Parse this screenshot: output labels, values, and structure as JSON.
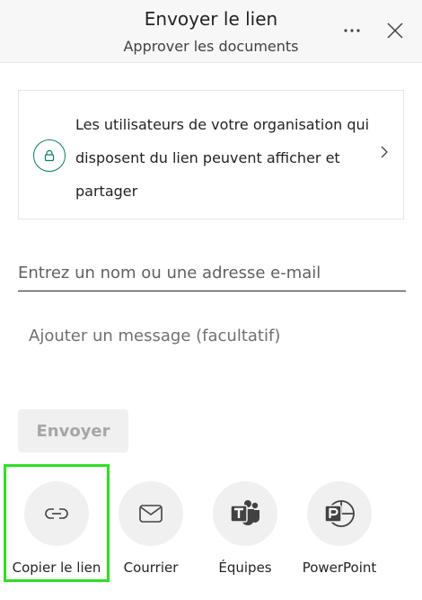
{
  "header": {
    "title": "Envoyer le lien",
    "subtitle": "Approver les documents",
    "more_icon": "more-horizontal-icon",
    "close_icon": "close-icon"
  },
  "link_settings": {
    "description": "Les utilisateurs de votre organisation qui disposent du lien peuvent afficher et partager",
    "icon": "lock-icon",
    "chevron_icon": "chevron-right-icon",
    "accent_color": "#0e7a6b"
  },
  "recipient": {
    "placeholder": "Entrez un nom ou une adresse e-mail",
    "value": ""
  },
  "message": {
    "placeholder": "Ajouter un message (facultatif)",
    "value": ""
  },
  "send_button": {
    "label": "Envoyer",
    "enabled": false
  },
  "share_options": [
    {
      "label": "Copier le lien",
      "icon": "link-icon"
    },
    {
      "label": "Courrier",
      "icon": "mail-icon"
    },
    {
      "label": "Équipes",
      "icon": "teams-icon"
    },
    {
      "label": "PowerPoint",
      "icon": "powerpoint-icon"
    }
  ],
  "highlight": {
    "target": "Copier le lien",
    "color": "#2ee021"
  }
}
